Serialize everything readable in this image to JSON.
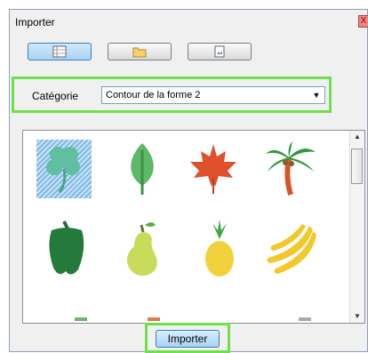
{
  "dialog": {
    "title": "Importer",
    "close_glyph": "X"
  },
  "toolbar": {
    "buttons": [
      {
        "icon": "list-view-icon",
        "active": true
      },
      {
        "icon": "folder-icon",
        "active": false
      },
      {
        "icon": "image-file-icon",
        "active": false
      }
    ]
  },
  "category": {
    "label": "Catégorie",
    "selected": "Contour de la forme 2"
  },
  "gallery": {
    "items": [
      {
        "icon": "clover-icon",
        "selected": true
      },
      {
        "icon": "leaf-icon",
        "selected": false
      },
      {
        "icon": "maple-leaf-icon",
        "selected": false
      },
      {
        "icon": "palm-tree-icon",
        "selected": false
      },
      {
        "icon": "bell-pepper-icon",
        "selected": false
      },
      {
        "icon": "pear-icon",
        "selected": false
      },
      {
        "icon": "pineapple-icon",
        "selected": false
      },
      {
        "icon": "banana-icon",
        "selected": false
      }
    ]
  },
  "import_button": {
    "label": "Importer"
  }
}
